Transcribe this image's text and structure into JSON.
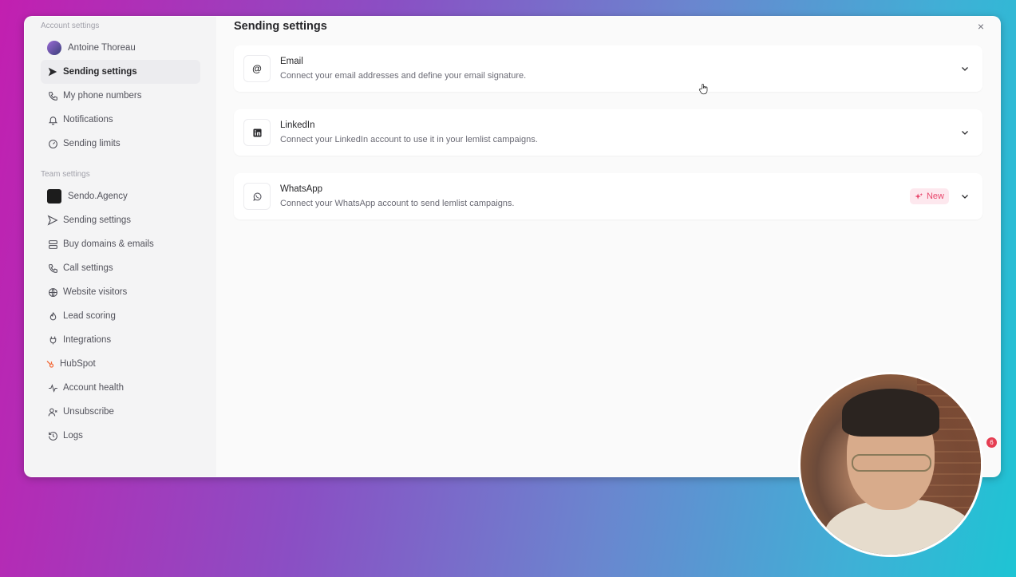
{
  "window": {
    "close_glyph": "×"
  },
  "sidebar": {
    "account_title": "Account settings",
    "account_items": [
      {
        "label": "Antoine Thoreau",
        "icon": "avatar"
      },
      {
        "label": "Sending settings",
        "icon": "send-icon",
        "active": true
      },
      {
        "label": "My phone numbers",
        "icon": "phone-icon"
      },
      {
        "label": "Notifications",
        "icon": "bell-icon"
      },
      {
        "label": "Sending limits",
        "icon": "gauge-icon"
      }
    ],
    "team_title": "Team settings",
    "team_items": [
      {
        "label": "Sendo.Agency",
        "icon": "agency-logo"
      },
      {
        "label": "Sending settings",
        "icon": "send-icon"
      },
      {
        "label": "Buy domains & emails",
        "icon": "server-icon"
      },
      {
        "label": "Call settings",
        "icon": "phone-icon"
      },
      {
        "label": "Website visitors",
        "icon": "globe-icon"
      },
      {
        "label": "Lead scoring",
        "icon": "flame-icon"
      },
      {
        "label": "Integrations",
        "icon": "plug-icon"
      },
      {
        "label": "HubSpot",
        "icon": "hubspot-icon"
      },
      {
        "label": "Account health",
        "icon": "activity-icon"
      },
      {
        "label": "Unsubscribe",
        "icon": "user-x-icon"
      },
      {
        "label": "Logs",
        "icon": "history-icon"
      }
    ]
  },
  "main": {
    "title": "Sending settings",
    "cards": [
      {
        "title": "Email",
        "desc": "Connect your email addresses and define your email signature.",
        "icon": "at-icon"
      },
      {
        "title": "LinkedIn",
        "desc": "Connect your LinkedIn account to use it in your lemlist campaigns.",
        "icon": "linkedin-icon"
      },
      {
        "title": "WhatsApp",
        "desc": "Connect your WhatsApp account to send lemlist campaigns.",
        "icon": "whatsapp-icon",
        "badge": "New"
      }
    ]
  },
  "notification_count": "6",
  "colors": {
    "accent_new": "#e8476c",
    "active_bg": "#ececef"
  }
}
